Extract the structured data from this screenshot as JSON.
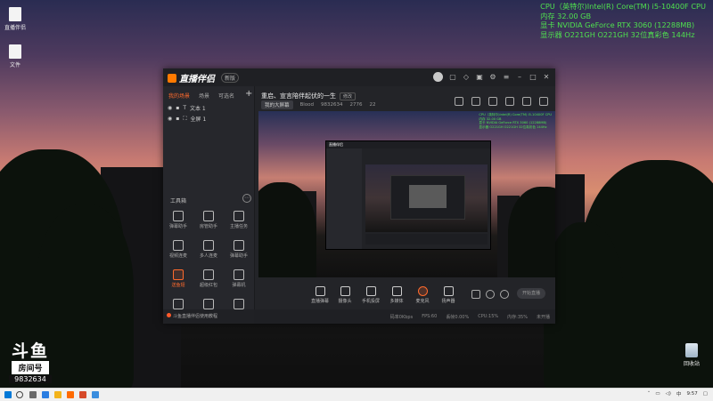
{
  "desktop": {
    "icons": [
      {
        "label": "直播伴侣"
      },
      {
        "label": "文件"
      }
    ],
    "recycle_label": "回收站"
  },
  "sysinfo": {
    "lines": [
      "CPU（英特尔)Intel(R) Core(TM) i5-10400F CPU",
      "内存  32.00 GB",
      "显卡  NVIDIA GeForce RTX 3060 (12288MB)",
      "显示器  O221GH O221GH 32位真彩色 144Hz"
    ]
  },
  "douyu": {
    "logo_text": "斗鱼",
    "room_label": "房间号",
    "room_number": "9832634"
  },
  "app": {
    "brand": "直播伴侣",
    "version_badge": "新版",
    "tabs": [
      "我的场景",
      "场景",
      "可选名"
    ],
    "active_tab": 0,
    "sources": [
      {
        "name": "文本 1"
      },
      {
        "name": "全屏 1"
      }
    ],
    "tools_title": "工具箱",
    "tools": [
      {
        "label": "弹幕助手",
        "hot": false
      },
      {
        "label": "房管助手",
        "hot": false
      },
      {
        "label": "主播任务",
        "hot": false
      },
      {
        "label": "视频连麦",
        "hot": false
      },
      {
        "label": "多人连麦",
        "hot": false
      },
      {
        "label": "弹幕助手",
        "hot": false
      },
      {
        "label": "送鱼翅",
        "hot": true
      },
      {
        "label": "超级红包",
        "hot": false
      },
      {
        "label": "弹幕机",
        "hot": false
      },
      {
        "label": "",
        "hot": false
      },
      {
        "label": "",
        "hot": false
      },
      {
        "label": "",
        "hot": false
      }
    ],
    "left_footer": "斗鱼直播伴侣使用教程",
    "room_title": "重启、宣言陪伴起伏的一生",
    "edit_label": "修改",
    "meta": {
      "category": "我的大屏幕",
      "streamer": "Blood",
      "room_id": "9832634",
      "heat": "2776",
      "viewers": "22"
    },
    "toolbar": [
      {
        "label": "直播弹幕"
      },
      {
        "label": "摄像头"
      },
      {
        "label": "手机投屏"
      },
      {
        "label": "多媒体"
      },
      {
        "label": "麦克风"
      },
      {
        "label": "扬声器"
      }
    ],
    "start_button": "开始直播",
    "status": [
      "码率0Kbps",
      "FPS:60",
      "丢帧0.00%",
      "CPU:15%",
      "内存:35%",
      "未开播"
    ]
  },
  "taskbar": {
    "time": "9:57",
    "lang": "中"
  }
}
